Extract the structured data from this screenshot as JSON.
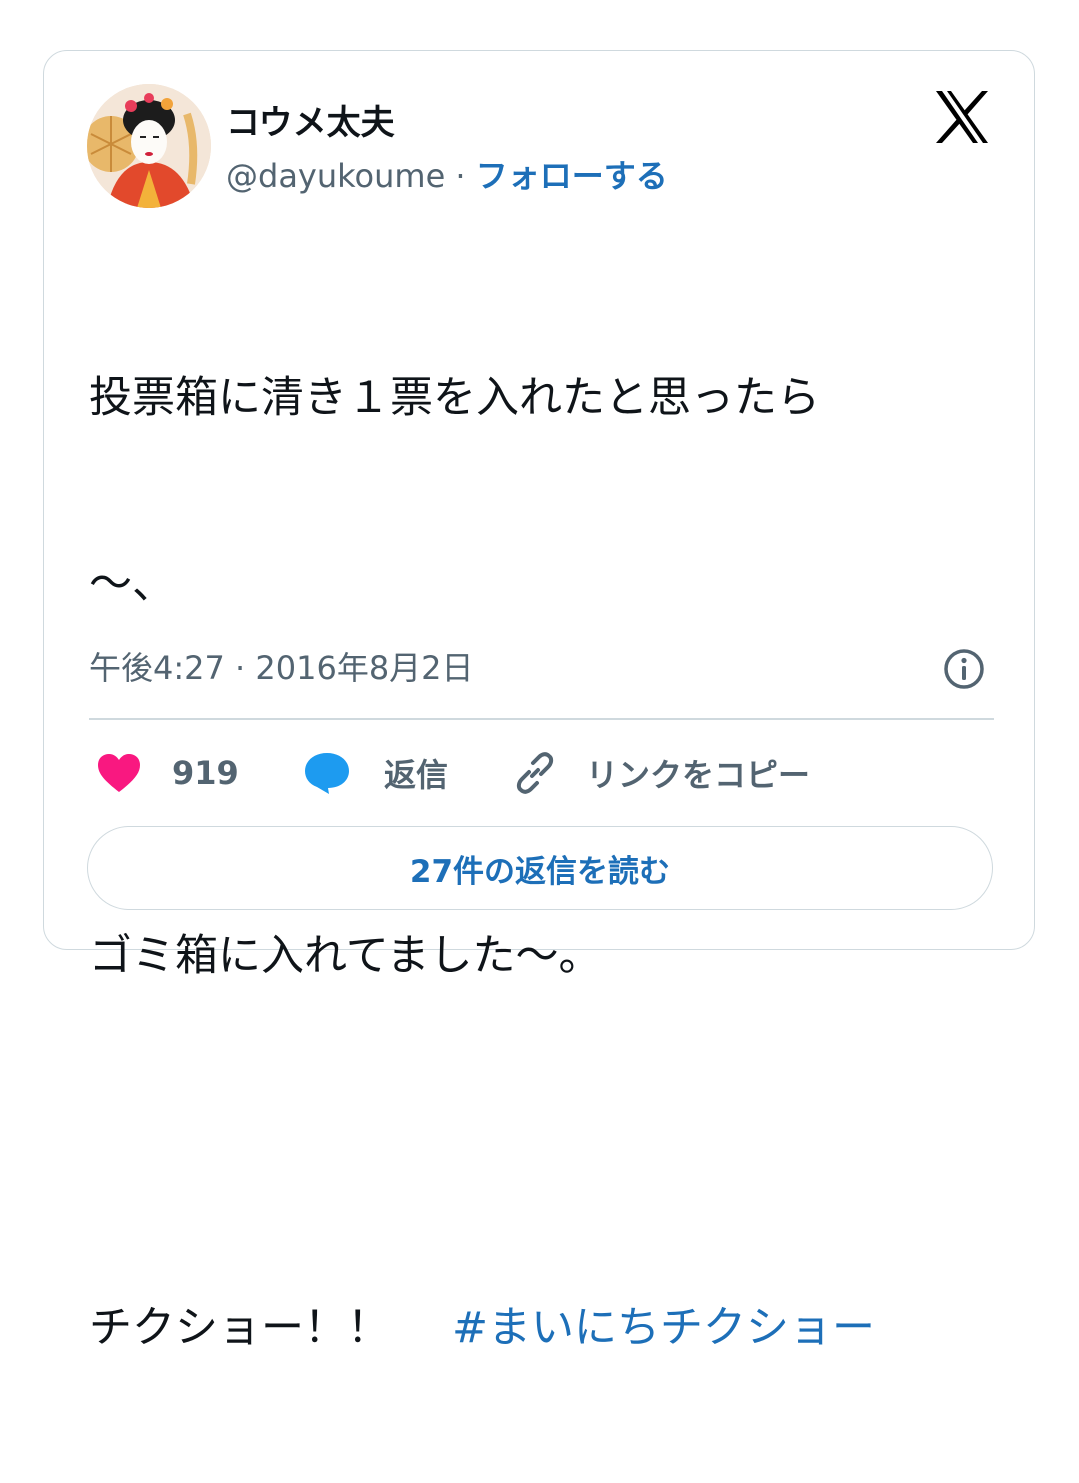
{
  "author": {
    "display_name": "コウメ太夫",
    "handle": "@dayukoume",
    "separator": " · ",
    "follow_label": "フォローする"
  },
  "tweet": {
    "lines": [
      "投票箱に清き１票を入れたと思ったら",
      "〜、",
      "",
      "ゴミ箱に入れてました〜。",
      ""
    ],
    "last_line_text": "チクショー！！",
    "hashtag": "#まいにちチクショー",
    "timestamp": "午後4:27 · 2016年8月2日"
  },
  "actions": {
    "like_count": "919",
    "reply_label": "返信",
    "copy_link_label": "リンクをコピー"
  },
  "read_replies_label": "27件の返信を読む",
  "colors": {
    "link": "#1d6fb8",
    "secondary_text": "#536471",
    "like_heart": "#f91880",
    "reply_bubble": "#1d9bf0",
    "border": "#cfd9de"
  },
  "icons": {
    "logo": "x-logo-icon",
    "info": "info-icon",
    "like": "heart-icon",
    "reply": "speech-bubble-icon",
    "copy": "link-icon"
  }
}
